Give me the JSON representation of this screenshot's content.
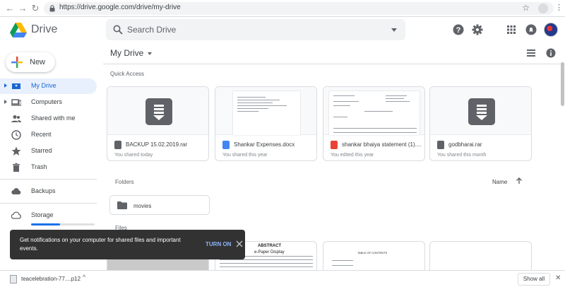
{
  "browser": {
    "url": "https://drive.google.com/drive/my-drive",
    "back_icon": "arrow-left",
    "forward_icon": "arrow-right",
    "reload_icon": "reload"
  },
  "app": {
    "brand": "Drive",
    "search_placeholder": "Search Drive",
    "new_label": "New"
  },
  "sidebar": {
    "items": [
      {
        "label": "My Drive",
        "icon": "my-drive",
        "active": true,
        "expandable": true
      },
      {
        "label": "Computers",
        "icon": "computers",
        "active": false,
        "expandable": true
      },
      {
        "label": "Shared with me",
        "icon": "shared",
        "active": false,
        "expandable": false
      },
      {
        "label": "Recent",
        "icon": "clock",
        "active": false,
        "expandable": false
      },
      {
        "label": "Starred",
        "icon": "star",
        "active": false,
        "expandable": false
      },
      {
        "label": "Trash",
        "icon": "trash",
        "active": false,
        "expandable": false
      }
    ],
    "backups_label": "Backups",
    "storage_label": "Storage",
    "storage_fraction": 0.45
  },
  "main": {
    "title": "My Drive",
    "quick_access_label": "Quick Access",
    "quick_access": [
      {
        "name": "BACKUP 15.02.2019.rar",
        "subtitle": "You shared today",
        "type": "archive"
      },
      {
        "name": "Shankar Expenses.docx",
        "subtitle": "You shared this year",
        "type": "word"
      },
      {
        "name": "shankar bhaiya statement (1)....",
        "subtitle": "You edited this year",
        "type": "pdf"
      },
      {
        "name": "godbharai.rar",
        "subtitle": "You shared this month",
        "type": "archive"
      }
    ],
    "folders_label": "Folders",
    "sort_label": "Name",
    "folders": [
      {
        "name": "movies"
      }
    ],
    "files_label": "Files",
    "file_thumbs": [
      {
        "title": "ABSTRACT",
        "subtitle": "e-Paper Display"
      },
      {
        "title": "TABLE OF CONTENTS",
        "subtitle": ""
      }
    ]
  },
  "snackbar": {
    "message": "Get notifications on your computer for shared files and important events.",
    "action": "TURN ON"
  },
  "downloads": {
    "file_name": "teacelebration-77....p12",
    "show_all": "Show all"
  },
  "colors": {
    "accent": "#1967d2",
    "active_bg": "#e8f0fe",
    "snackbar_bg": "#323232",
    "snackbar_action": "#8ab4f8"
  }
}
